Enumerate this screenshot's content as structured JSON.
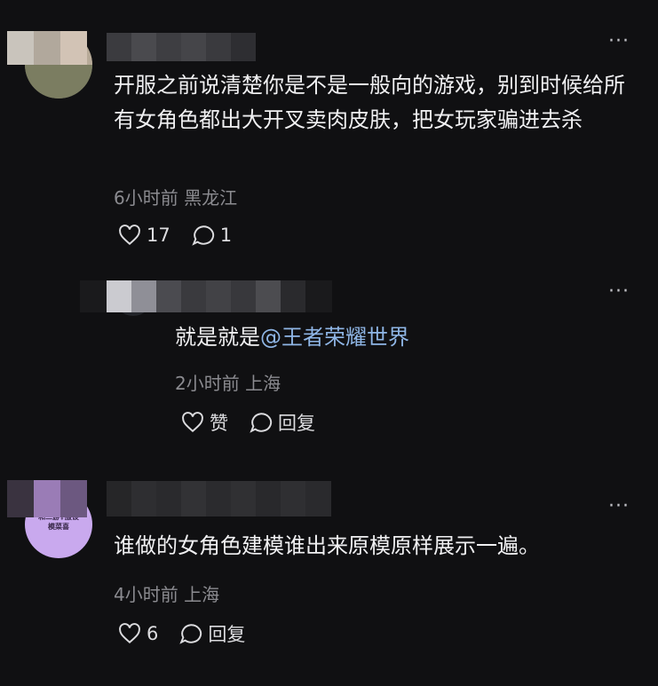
{
  "comments": [
    {
      "text": "开服之前说清楚你是不是一般向的游戏，别到时候给所有女角色都出大开叉卖肉皮肤，把女玩家骗进去杀",
      "time": "6小时前",
      "location": "黑龙江",
      "likes": "17",
      "replies": "1",
      "reply": {
        "text_prefix": "就是就是",
        "mention": "@王者荣耀世界",
        "time": "2小时前",
        "location": "上海",
        "like_label": "赞",
        "reply_label": "回复"
      }
    },
    {
      "text": "谁做的女角色建模谁出来原模原样展示一遍。",
      "time": "4小时前",
      "location": "上海",
      "likes": "6",
      "reply_label": "回复",
      "avatar_text_line1": "和二游♀服设",
      "avatar_text_line2": "模菜喜"
    }
  ],
  "more_glyph": "···"
}
